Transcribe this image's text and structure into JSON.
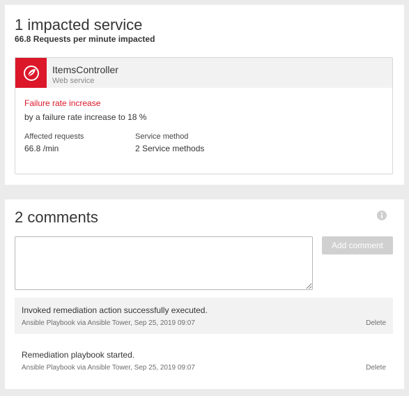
{
  "impacted": {
    "title": "1 impacted service",
    "subtitle": "66.8 Requests per minute impacted",
    "service": {
      "name": "ItemsController",
      "type": "Web service",
      "logo_icon": "spring-leaf-icon",
      "logo_color": "#dc172a"
    },
    "failure": {
      "title": "Failure rate increase",
      "description": "by a failure rate increase to 18 %",
      "title_color": "#dc172a"
    },
    "metrics": [
      {
        "label": "Affected requests",
        "value": "66.8 /min"
      },
      {
        "label": "Service method",
        "value": "2 Service methods"
      }
    ]
  },
  "comments": {
    "title": "2 comments",
    "info_icon": "info-icon",
    "input_value": "",
    "add_label": "Add comment",
    "items": [
      {
        "text": "Invoked remediation action successfully executed.",
        "meta": "Ansible Playbook via Ansible Tower, Sep 25, 2019 09:07",
        "delete_label": "Delete"
      },
      {
        "text": "Remediation playbook started.",
        "meta": "Ansible Playbook via Ansible Tower, Sep 25, 2019 09:07",
        "delete_label": "Delete"
      }
    ]
  }
}
